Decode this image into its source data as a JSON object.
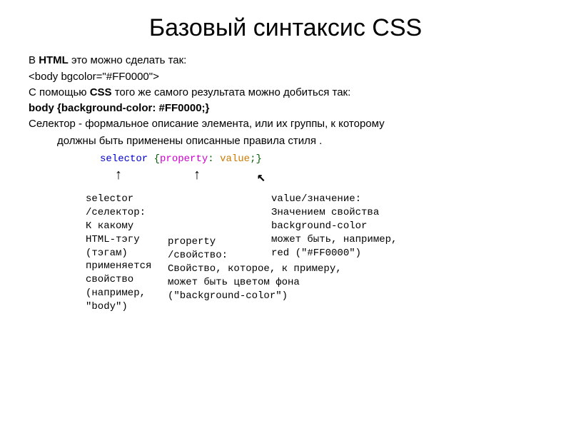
{
  "title": "Базовый синтаксис CSS",
  "lines": {
    "l1a": "В ",
    "l1b": "HTML",
    "l1c": " это можно сделать так:",
    "l2": "<body bgcolor=\"#FF0000\">",
    "l3a": "С помощью ",
    "l3b": "CSS",
    "l3c": " того же самого результата можно добиться так:",
    "l4": " body {background-color: #FF0000;}",
    "l5": "Селектор - формальное описание элемента, или их группы, к которому",
    "l6": "должны быть применены описанные правила стиля  ."
  },
  "syntax": {
    "selector": "selector",
    "lbrace": " {",
    "property": "property",
    "colon": ": ",
    "value": "value",
    "end": ";}"
  },
  "annotations": {
    "sel": "selector\n/селектор:\nК какому\nHTML-тэгу\n(тэгам)\nприменяется\nсвойство\n(например,\n\"body\")",
    "prop": "property\n/свойство:\nСвойство, которое, к примеру,\nможет быть цветом фона\n(\"background-color\")",
    "val": "value/значение:\nЗначением свойства\nbackground-color\nможет быть, например,\nred (\"#FF0000\")"
  }
}
